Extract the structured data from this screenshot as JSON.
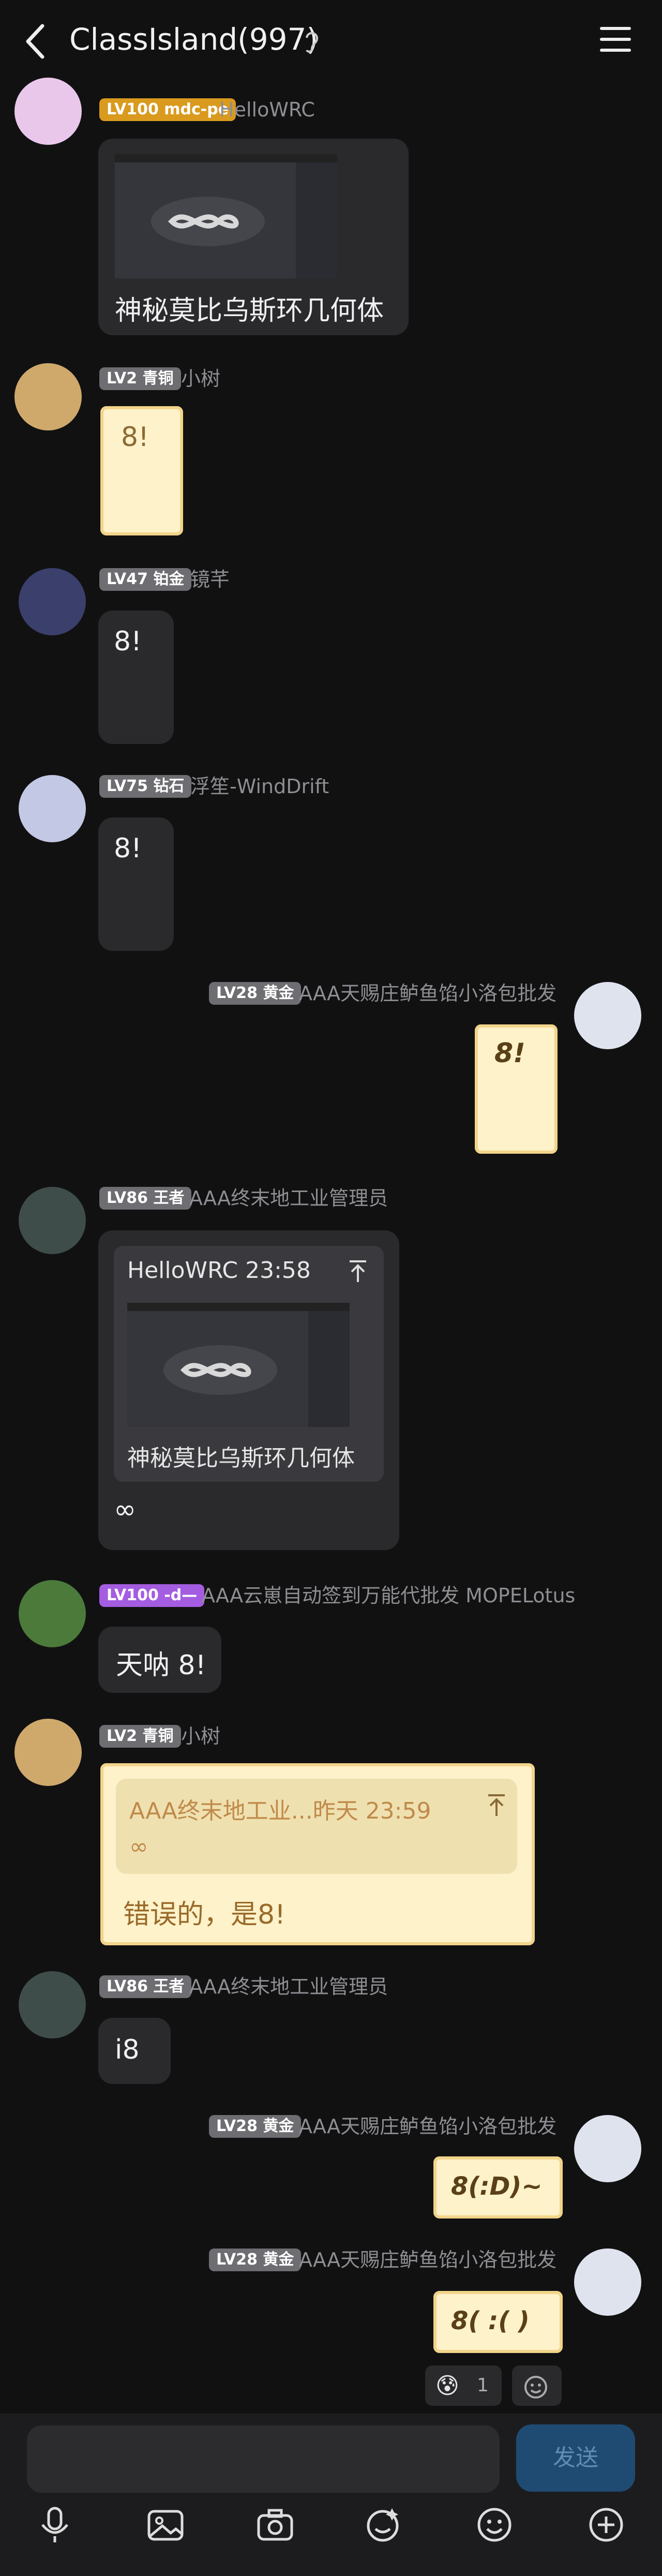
{
  "header": {
    "title": "ClassIsland(997)"
  },
  "messages": [
    {
      "badge": "LV100 mdc-pe",
      "nick": "HelloWRC",
      "text": "神秘莫比乌斯环几何体"
    },
    {
      "badge": "LV2 青铜",
      "nick": "小树",
      "text": "8!"
    },
    {
      "badge": "LV47 铂金",
      "nick": "镜芊",
      "text": "8!"
    },
    {
      "badge": "LV75 钻石",
      "nick": "浮笙-WindDrift",
      "text": "8!"
    },
    {
      "badge": "LV28 黄金",
      "nick": "AAA天赐庄鲈鱼馅小洛包批发",
      "text": "8!"
    },
    {
      "badge": "LV86 王者",
      "nick": "AAA终末地工业管理员",
      "quote_head": "HelloWRC 23:58",
      "quote_text": "神秘莫比乌斯环几何体",
      "text": "∞"
    },
    {
      "badge": "LV100 -d—",
      "nick": "AAA云崽自动签到万能代批发 MOPELotus",
      "text": "天呐 8!"
    },
    {
      "badge": "LV2 青铜",
      "nick": "小树",
      "quote_head": "AAA终末地工业...昨天 23:59",
      "quote_text": "∞",
      "text": "错误的，是8!"
    },
    {
      "badge": "LV86 王者",
      "nick": "AAA终末地工业管理员",
      "text": "i8"
    },
    {
      "badge": "LV28 黄金",
      "nick": "AAA天赐庄鲈鱼馅小洛包批发",
      "text": "8(:D)~"
    },
    {
      "badge": "LV28 黄金",
      "nick": "AAA天赐庄鲈鱼馅小洛包批发",
      "text": "8( :( )"
    }
  ],
  "reaction": {
    "emoji": "😰",
    "count": "1"
  },
  "composer": {
    "placeholder": "",
    "send_label": "发送"
  },
  "colors": {
    "gold": "#d99a1e",
    "purple": "#a45de0",
    "gray": "#6d6d72",
    "send": "#1f4b72"
  }
}
